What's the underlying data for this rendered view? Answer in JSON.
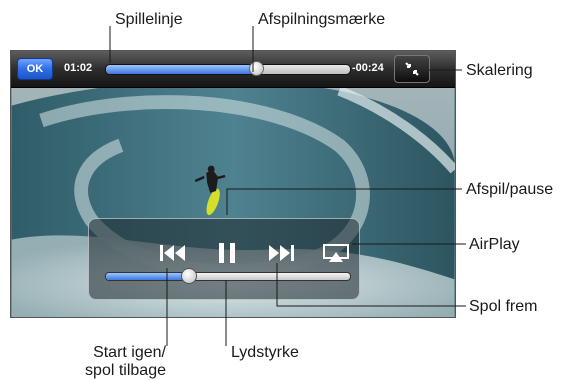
{
  "player": {
    "done_label": "OK",
    "elapsed": "01:02",
    "remaining": "-00:24",
    "playhead_fraction": 0.62,
    "volume_fraction": 0.34
  },
  "callouts": {
    "scrubber_bar": "Spillelinje",
    "playhead": "Afspilningsmærke",
    "scale": "Skalering",
    "play_pause": "Afspil/pause",
    "airplay": "AirPlay",
    "fast_forward": "Spol frem",
    "restart_line1": "Start igen/",
    "restart_line2": "spol tilbage",
    "volume": "Lydstyrke"
  },
  "icons": {
    "scale": "scale-icon",
    "previous": "previous-icon",
    "play_pause": "pause-icon",
    "next": "next-icon",
    "airplay": "airplay-icon"
  },
  "colors": {
    "accent_blue": "#3d78e0",
    "wave": "#4f7883"
  }
}
